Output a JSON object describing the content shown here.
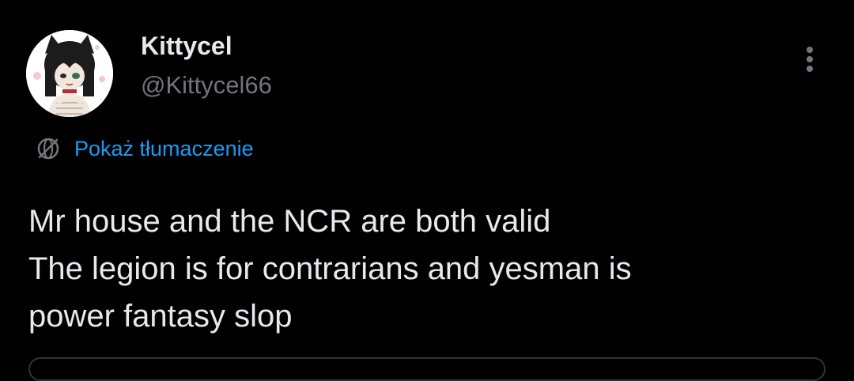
{
  "author": {
    "name": "Kittycel",
    "handle": "@Kittycel66"
  },
  "avatar": {
    "icon": "anime-catgirl-avatar-icon"
  },
  "translate": {
    "icon": "translate-globe-icon",
    "label": "Pokaż tłumaczenie"
  },
  "tweet": {
    "lines": [
      "Mr house and the NCR are both valid",
      "The legion is for contrarians and yesman is",
      "power fantasy slop"
    ]
  },
  "more": {
    "icon": "more-vertical-icon"
  },
  "colors": {
    "background": "#000000",
    "primary_text": "#e7e9ea",
    "secondary_text": "#71767b",
    "link": "#1d9bf0",
    "border": "#2f3336"
  }
}
